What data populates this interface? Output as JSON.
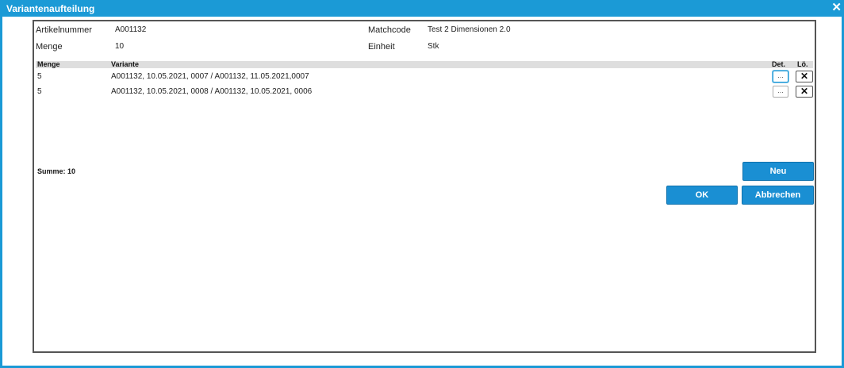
{
  "window": {
    "title": "Variantenaufteilung",
    "close_glyph": "✕"
  },
  "header": {
    "artikelnummer_label": "Artikelnummer",
    "artikelnummer_value": "A001132",
    "menge_label": "Menge",
    "menge_value": "10",
    "matchcode_label": "Matchcode",
    "matchcode_value": "Test 2 Dimensionen 2.0",
    "einheit_label": "Einheit",
    "einheit_value": "Stk"
  },
  "grid": {
    "columns": {
      "menge": "Menge",
      "variante": "Variante",
      "det": "Det.",
      "loe": "Lö."
    },
    "rows": [
      {
        "menge": "5",
        "variante": "A001132, 10.05.2021, 0007 / A001132, 11.05.2021,0007",
        "det": "...",
        "del": "✕"
      },
      {
        "menge": "5",
        "variante": "A001132, 10.05.2021, 0008 / A001132, 10.05.2021, 0006",
        "det": "...",
        "del": "✕"
      }
    ]
  },
  "summary": {
    "text": "Summe: 10"
  },
  "buttons": {
    "neu": "Neu",
    "ok": "OK",
    "abbrechen": "Abbrechen"
  },
  "colors": {
    "accent": "#1b9ad6",
    "button": "#1a8fd3",
    "grid_header": "#dedede"
  }
}
